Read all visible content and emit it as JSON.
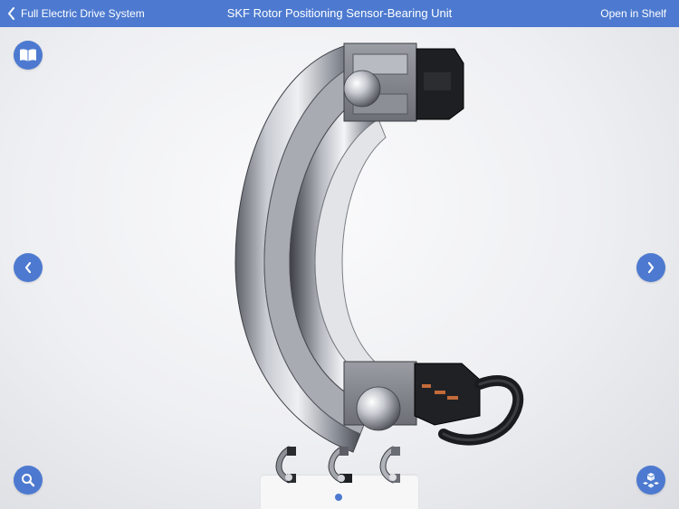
{
  "topbar": {
    "back_label": "Full Electric Drive System",
    "title": "SKF Rotor Positioning Sensor-Bearing Unit",
    "open_shelf_label": "Open in Shelf"
  },
  "icons": {
    "back": "chevron-left-icon",
    "book": "book-icon",
    "prev": "chevron-left-icon",
    "next": "chevron-right-icon",
    "search": "search-icon",
    "explode": "explode-view-icon"
  },
  "viewer": {
    "model_name": "SKF Rotor Positioning Sensor-Bearing Unit",
    "thumbnails_count": 3,
    "current_page": 1
  },
  "colors": {
    "accent": "#4d7ad0"
  }
}
